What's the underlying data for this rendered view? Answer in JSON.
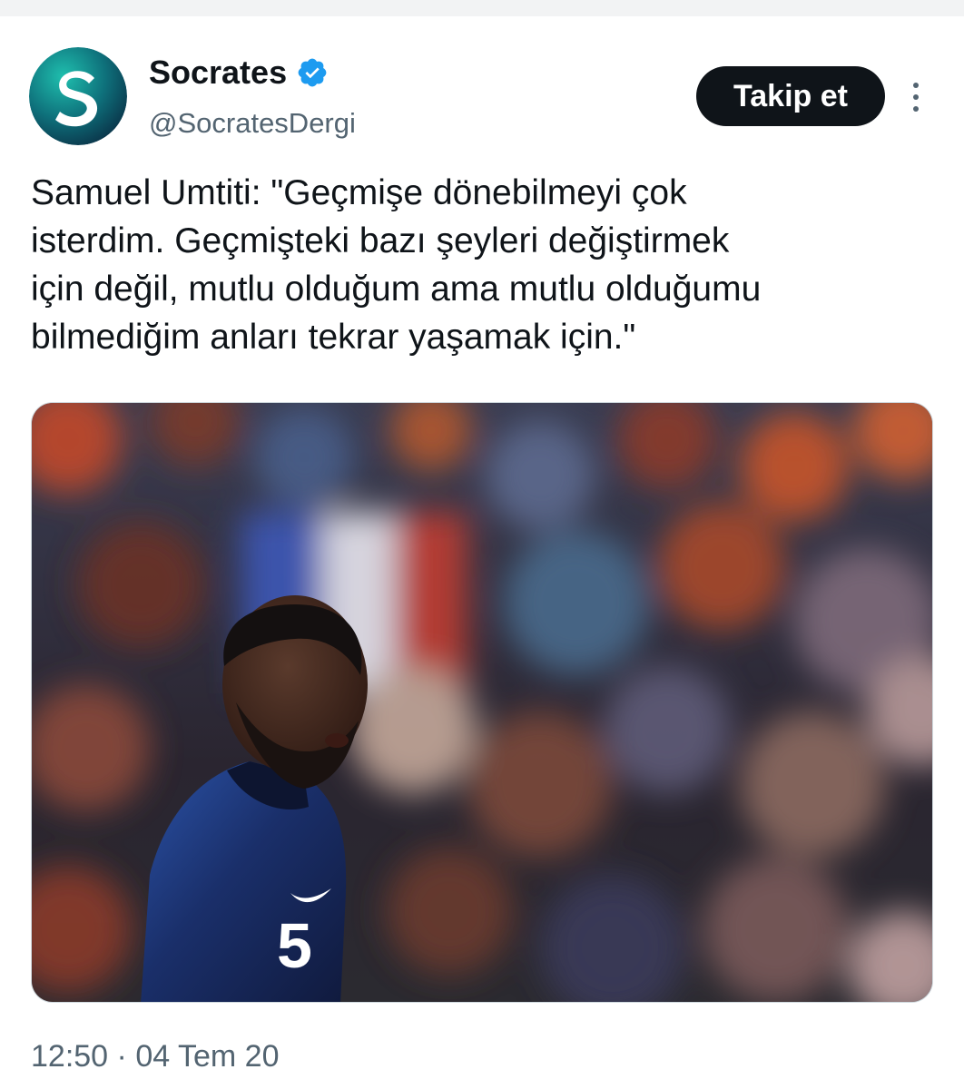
{
  "account": {
    "display_name": "Socrates",
    "handle": "@SocratesDergi",
    "avatar_letter": "S",
    "verified": true
  },
  "actions": {
    "follow_label": "Takip et",
    "more_icon": "more-vertical-icon"
  },
  "tweet": {
    "text": "Samuel Umtiti: \"Geçmişe dönebilmeyi çok\nisterdim. Geçmişteki bazı şeyleri değiştirmek\niçin değil, mutlu olduğum ama mutlu olduğumu\nbilmediğim anları tekrar yaşamak için.\"",
    "media_jersey_number": "5",
    "time": "12:50",
    "separator": "·",
    "date": "04 Tem 20"
  },
  "colors": {
    "text_primary": "#0f1419",
    "text_secondary": "#536471",
    "verified_blue": "#1d9bf0",
    "avatar_bg_dark": "#0a3b4a",
    "avatar_bg_light": "#1aa6a0",
    "follow_bg": "#0f1419",
    "jersey_navy": "#14234a"
  }
}
